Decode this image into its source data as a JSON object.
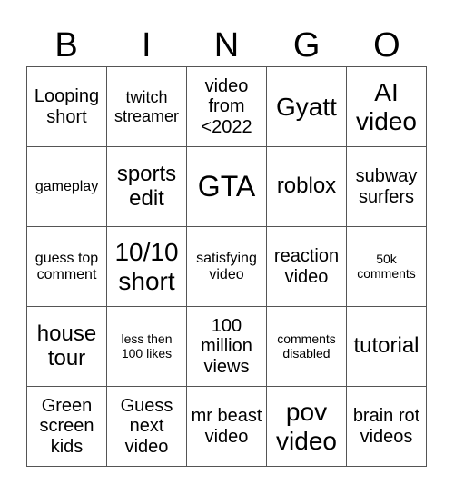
{
  "header": {
    "letters": [
      "B",
      "I",
      "N",
      "G",
      "O"
    ]
  },
  "cells": [
    "Looping short",
    "twitch streamer",
    "video from <2022",
    "Gyatt",
    "AI video",
    "gameplay",
    "sports edit",
    "GTA",
    "roblox",
    "subway surfers",
    "guess top comment",
    "10/10 short",
    "satisfying video",
    "reaction video",
    "50k comments",
    "house tour",
    "less then 100 likes",
    "100 million views",
    "comments disabled",
    "tutorial",
    "Green screen kids",
    "Guess next video",
    "mr beast video",
    "pov video",
    "brain rot videos"
  ]
}
